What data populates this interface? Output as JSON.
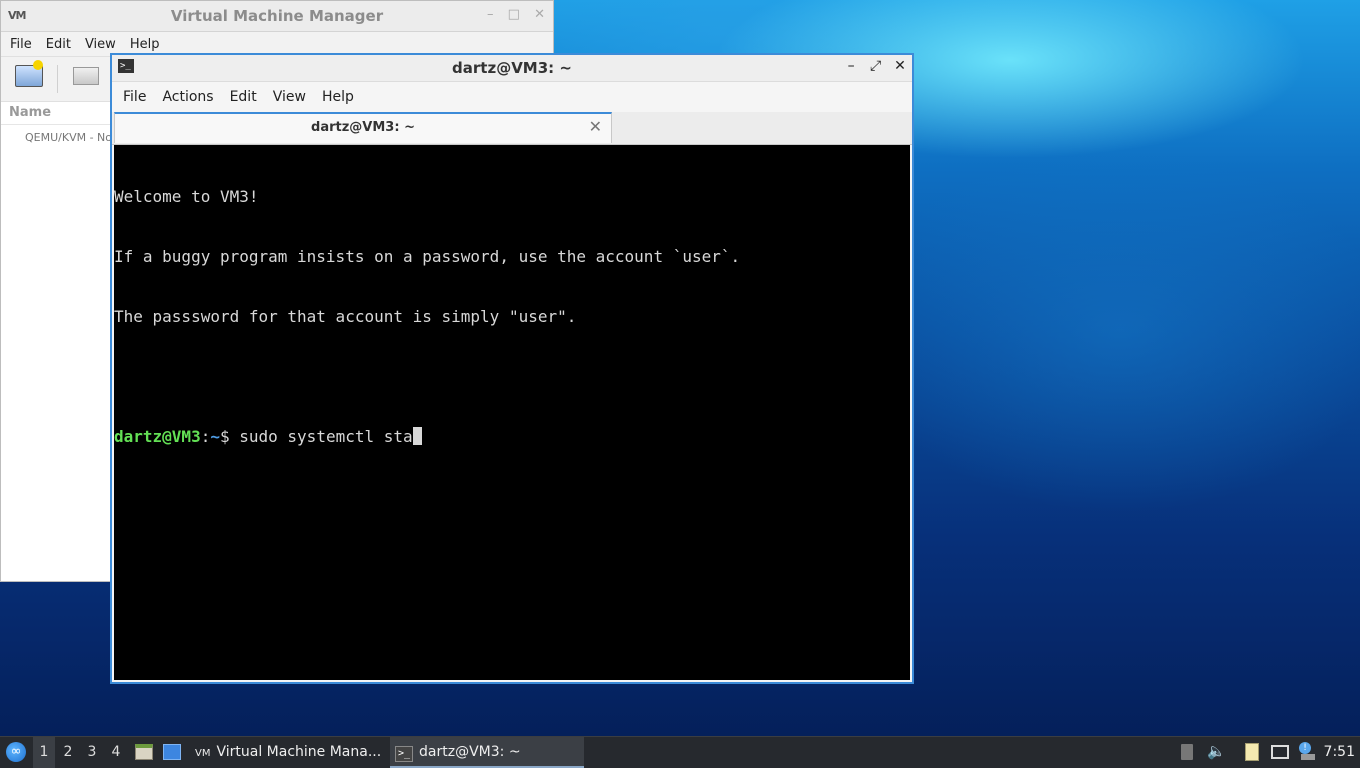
{
  "vmm": {
    "title": "Virtual Machine Manager",
    "app_icon": "VM",
    "menu": [
      "File",
      "Edit",
      "View",
      "Help"
    ],
    "column_header": "Name",
    "connection_row": "QEMU/KVM - No"
  },
  "terminal": {
    "title": "dartz@VM3: ~",
    "menu": [
      "File",
      "Actions",
      "Edit",
      "View",
      "Help"
    ],
    "tab_label": "dartz@VM3: ~",
    "lines": [
      "Welcome to VM3!",
      "If a buggy program insists on a password, use the account `user`.",
      "The passsword for that account is simply \"user\"."
    ],
    "prompt_user": "dartz@VM3",
    "prompt_sep": ":",
    "prompt_path": "~",
    "prompt_symbol": "$ ",
    "command": "sudo systemctl sta"
  },
  "taskbar": {
    "workspaces": [
      "1",
      "2",
      "3",
      "4"
    ],
    "active_workspace": "1",
    "tasks": [
      {
        "label": "Virtual Machine Mana...",
        "icon": "vmm-icon"
      },
      {
        "label": "dartz@VM3: ~",
        "icon": "terminal-icon"
      }
    ],
    "clock": "7:51"
  },
  "colors": {
    "prompt_user": "#63e055",
    "prompt_path": "#4f9de6",
    "window_border": "#3c8bd8"
  }
}
